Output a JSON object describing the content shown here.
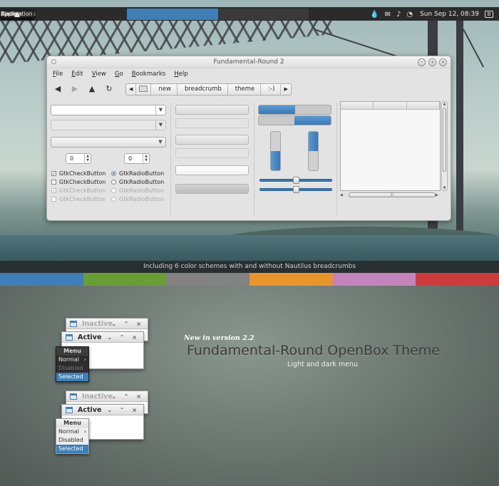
{
  "top_panel": {
    "logo_icon": "distro-logo-icon",
    "menus": [
      "Applications",
      "Places",
      "System"
    ],
    "tray_icons": [
      "drop-icon",
      "mail-icon",
      "music-note-icon",
      "rss-icon"
    ],
    "clock": "Sun Sep 12, 08:39",
    "battery_label": "B"
  },
  "window": {
    "title": "Fundamental-Round 2",
    "menu": [
      "File",
      "Edit",
      "View",
      "Go",
      "Bookmarks",
      "Help"
    ],
    "breadcrumbs": [
      "new",
      "breadcrumb",
      "theme"
    ],
    "breadcrumb_overflow": ":-)",
    "spin_values": [
      "0",
      "0"
    ],
    "checks": [
      {
        "label": "GtkCheckButton",
        "checked": true,
        "disabled": false
      },
      {
        "label": "GtkCheckButton",
        "checked": false,
        "disabled": false
      },
      {
        "label": "GtkCheckButton",
        "checked": true,
        "disabled": true
      },
      {
        "label": "GtkCheckButton",
        "checked": false,
        "disabled": true
      }
    ],
    "radios": [
      {
        "label": "GtkRadioButton",
        "selected": true,
        "disabled": false
      },
      {
        "label": "GtkRadioButton",
        "selected": false,
        "disabled": false
      },
      {
        "label": "GtkRadioButton",
        "selected": false,
        "disabled": true
      },
      {
        "label": "GtkRadioButton",
        "selected": false,
        "disabled": true
      }
    ],
    "progress": {
      "left_fill": 0.5,
      "right_fill": 0.5,
      "v_left_fill": 0.5,
      "v_right_fill": 0.5
    },
    "sliders": [
      0.5,
      0.5
    ],
    "accent": "#3a78b4"
  },
  "caption": "Including 6 color schemes with and without Nautilus breadcrumbs",
  "color_schemes": [
    "#3d7fb6",
    "#6a9e34",
    "#828282",
    "#e8952e",
    "#c483bb",
    "#cc3c3c"
  ],
  "openbox": {
    "inactive_label": "Inactive",
    "active_label": "Active",
    "menu_header": "Menu",
    "menu_items": [
      "Normal",
      "Disabled",
      "Selected"
    ],
    "controls": "⌄ ⌃ ×"
  },
  "promo": {
    "new_label": "New in version 2.2",
    "title": "Fundamental-Round OpenBox Theme",
    "subtitle": "Light and dark menu"
  }
}
